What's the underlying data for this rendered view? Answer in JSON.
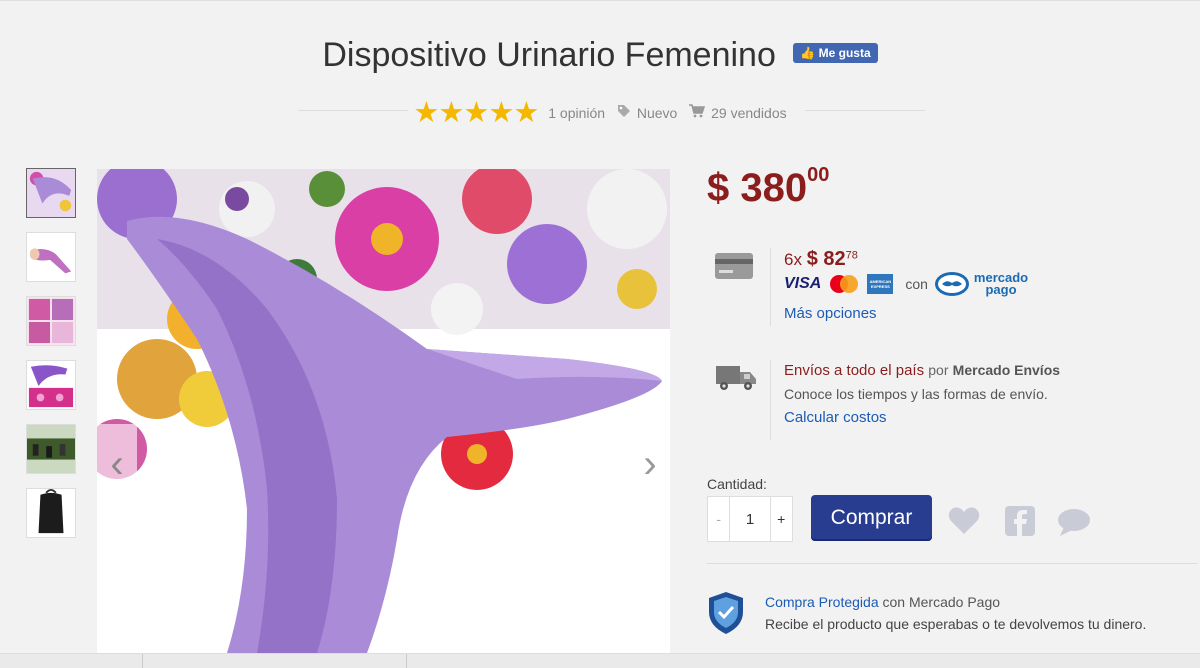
{
  "product": {
    "title": "Dispositivo Urinario Femenino",
    "like_button": "Me gusta",
    "rating_stars": 5,
    "opinions": "1 opinión",
    "condition": "Nuevo",
    "sold": "29 vendidos"
  },
  "gallery": {
    "thumbnail_count": 6,
    "active_thumbnail": 0
  },
  "price": {
    "currency": "$",
    "amount": "380",
    "cents": "00"
  },
  "payment": {
    "installments_prefix": "6x",
    "installment_currency": "$",
    "installment_amount": "82",
    "installment_cents": "78",
    "visa_label": "VISA",
    "amex_label": "AMERICAN EXPRESS",
    "con_label": "con",
    "mp_line1": "mercado",
    "mp_line2": "pago",
    "more_options": "Más opciones"
  },
  "shipping": {
    "headline": "Envíos a todo el país",
    "by": "por",
    "provider": "Mercado Envíos",
    "description": "Conoce los tiempos y las formas de envío.",
    "calculate_link": "Calcular costos"
  },
  "purchase": {
    "quantity_label": "Cantidad:",
    "quantity_value": "1",
    "minus": "-",
    "plus": "+",
    "buy_button": "Comprar"
  },
  "protection": {
    "title_link": "Compra Protegida",
    "title_rest": "con Mercado Pago",
    "description": "Recibe el producto que esperabas o te devolvemos tu dinero."
  },
  "colors": {
    "price_red": "#8b1d1d",
    "buy_blue": "#283d8f",
    "link_blue": "#1c5bb5",
    "star_gold": "#f5b800",
    "product_purple": "#a98bd8"
  }
}
